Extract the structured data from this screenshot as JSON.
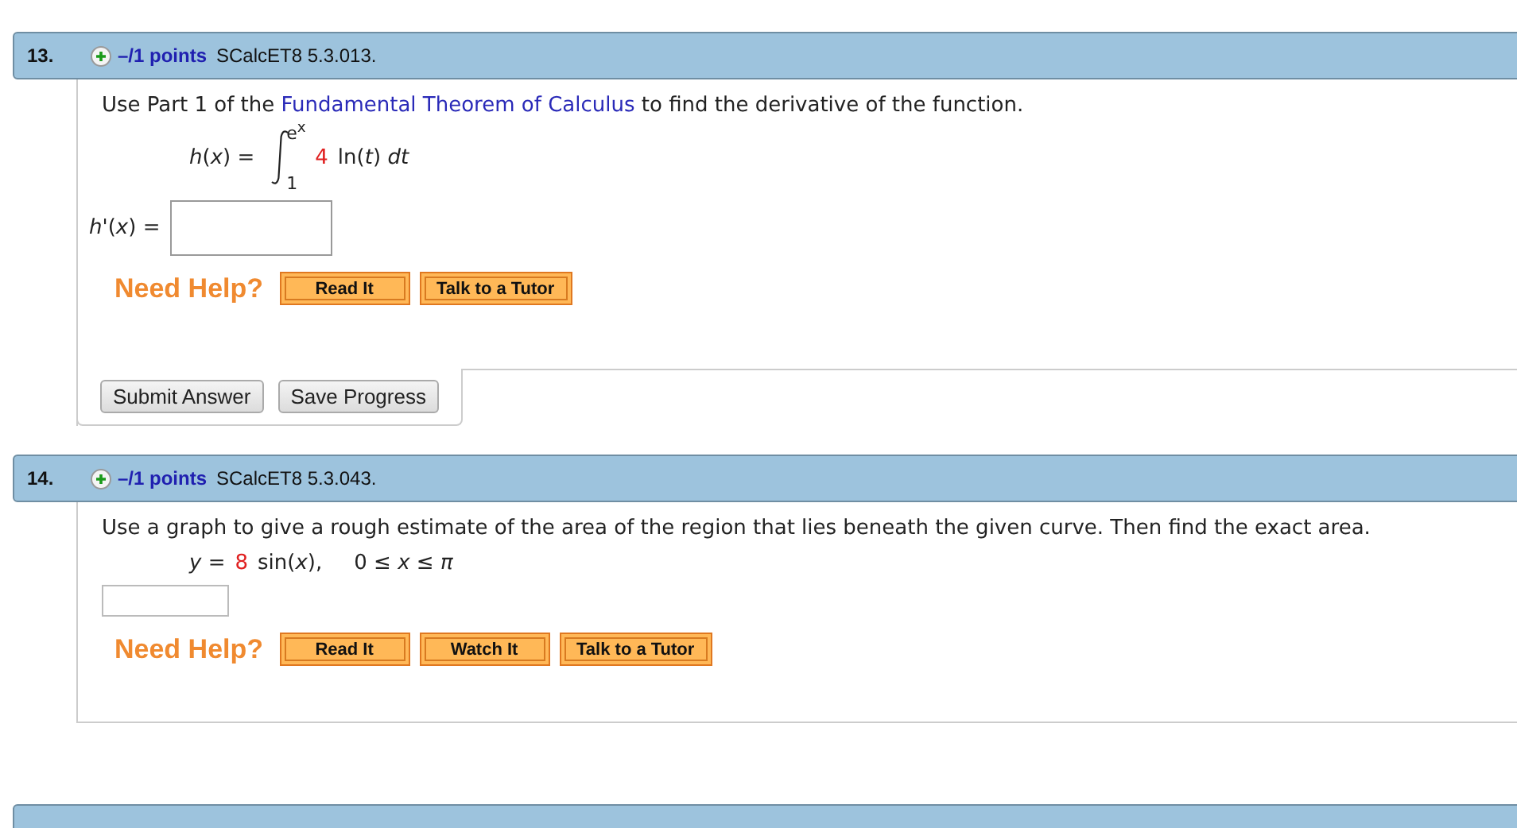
{
  "questions": [
    {
      "number": "13.",
      "points": "–/1 points",
      "code": "SCalcET8 5.3.013.",
      "prompt": [
        {
          "kind": "text",
          "text": "Use Part 1 of the "
        },
        {
          "kind": "link",
          "text": "Fundamental Theorem of Calculus"
        },
        {
          "kind": "text",
          "text": " to find the derivative of the function."
        }
      ],
      "formula": [
        {
          "kind": "text",
          "text": "*h*(*x*) ="
        },
        {
          "kind": "integral",
          "upper": "e$^{x}$",
          "lower": "1"
        },
        {
          "kind": "coefficient",
          "text": "4"
        },
        {
          "kind": "text",
          "text": "ln(*t*) *dt*"
        }
      ],
      "answer": {
        "kind": "labeled",
        "label": "*h*'(*x*) ="
      },
      "help": {
        "label": "Need Help?",
        "buttons": [
          "Read It",
          "Talk to a Tutor"
        ]
      },
      "actions": [
        "Submit Answer",
        "Save Progress"
      ]
    },
    {
      "number": "14.",
      "points": "–/1 points",
      "code": "SCalcET8 5.3.043.",
      "prompt": [
        {
          "kind": "text",
          "text": "Use a graph to give a rough estimate of the area of the region that lies beneath the given curve. Then find the exact area."
        }
      ],
      "formula": [
        {
          "kind": "text",
          "text": "*y* ="
        },
        {
          "kind": "coefficient",
          "text": "8"
        },
        {
          "kind": "text",
          "text": "sin(*x*),"
        },
        {
          "kind": "range",
          "text": "0 ≤ *x* ≤ *π*"
        }
      ],
      "answer": {
        "kind": "plain"
      },
      "help": {
        "label": "Need Help?",
        "buttons": [
          "Read It",
          "Watch It",
          "Talk to a Tutor"
        ]
      }
    }
  ],
  "more_below": true
}
